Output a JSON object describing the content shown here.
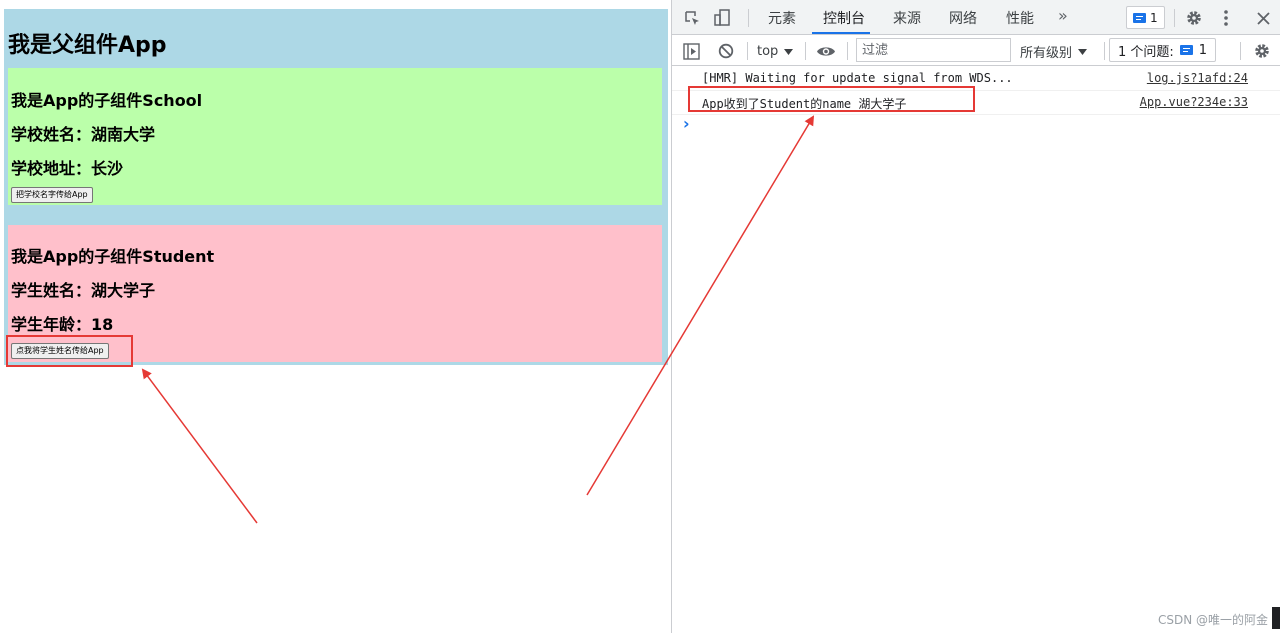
{
  "app": {
    "title": "我是父组件App",
    "school": {
      "heading": "我是App的子组件School",
      "name_line": "学校姓名：湖南大学",
      "address_line": "学校地址：长沙",
      "button_label": "把学校名字传给App",
      "bg_color": "#bbffaa"
    },
    "student": {
      "heading": "我是App的子组件Student",
      "name_line": "学生姓名：湖大学子",
      "age_line": "学生年龄：18",
      "button_label": "点我将学生姓名传给App",
      "bg_color": "#ffc0cb"
    },
    "root_bg_color": "#add8e6"
  },
  "devtools": {
    "tabs": [
      {
        "label": "元素",
        "active": false
      },
      {
        "label": "控制台",
        "active": true
      },
      {
        "label": "来源",
        "active": false
      },
      {
        "label": "网络",
        "active": false
      },
      {
        "label": "性能",
        "active": false
      }
    ],
    "more_tabs": "»",
    "issues_badge_count": "1",
    "context_label": "top",
    "filter_placeholder": "过滤",
    "level_label": "所有级别",
    "issues_label": "1 个问题:",
    "issues_count": "1",
    "console": [
      {
        "text": "[HMR] Waiting for update signal from WDS...",
        "source": "log.js?1afd:24"
      },
      {
        "text": "App收到了Student的name 湖大学子",
        "source": "App.vue?234e:33"
      }
    ],
    "prompt_symbol": "›",
    "icons": [
      "inspect-icon",
      "device-toggle-icon",
      "gear-icon",
      "kebab-menu-icon",
      "close-icon",
      "sidebar-toggle-icon",
      "clear-console-icon",
      "dropdown-arrow-icon",
      "eye-icon"
    ]
  },
  "annotation_color": "#e53935",
  "watermark": "CSDN @唯一的阿金"
}
